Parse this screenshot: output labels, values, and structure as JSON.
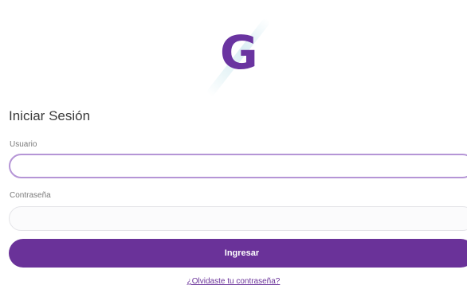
{
  "logo": {
    "letter": "G",
    "color": "#6a34a0"
  },
  "form": {
    "title": "Iniciar Sesión",
    "username_label": "Usuario",
    "username_value": "",
    "password_label": "Contraseña",
    "password_value": "",
    "submit_label": "Ingresar",
    "forgot_link": "¿Olvidaste tu contraseña?"
  },
  "colors": {
    "primary": "#6a3299",
    "focus_border": "#b595d6",
    "title_text": "#3a3a3a",
    "label_text": "#7a7a7a"
  }
}
